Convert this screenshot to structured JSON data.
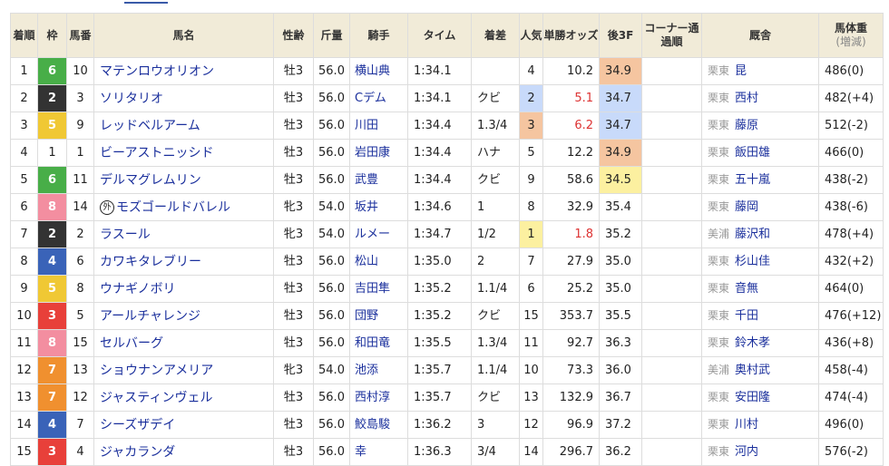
{
  "headers": {
    "rank": "着順",
    "waku": "枠",
    "uma": "馬番",
    "name": "馬名",
    "sexage": "性齢",
    "weight": "斤量",
    "jockey": "騎手",
    "time": "タイム",
    "margin": "着差",
    "pop": "人気",
    "odds": "単勝オッズ",
    "last3f": "後3F",
    "corner": "コーナー通過順",
    "trainer": "厩舎",
    "body": "馬体重",
    "body_sub": "(増減)"
  },
  "bracket_colors": {
    "1": "#ffffff",
    "2": "#333333",
    "3": "#e8403a",
    "4": "#3a63b8",
    "5": "#f0c834",
    "6": "#48ae48",
    "7": "#f0902f",
    "8": "#f38ea0"
  },
  "rows": [
    {
      "rank": "1",
      "waku": "6",
      "waku_color": "#48ae48",
      "uma": "10",
      "name": "マテンロウオリオン",
      "mark": "",
      "sexage": "牡3",
      "weight": "56.0",
      "jockey": "横山典",
      "time": "1:34.1",
      "margin": "",
      "pop": "4",
      "odds": "10.2",
      "odds_red": false,
      "last3f": "34.9",
      "f3hl": "o",
      "pophl": "",
      "aff": "栗東",
      "trainer": "昆",
      "body": "486(0)"
    },
    {
      "rank": "2",
      "waku": "2",
      "waku_color": "#333333",
      "uma": "3",
      "name": "ソリタリオ",
      "mark": "",
      "sexage": "牡3",
      "weight": "56.0",
      "jockey": "Cデム",
      "time": "1:34.1",
      "margin": "クビ",
      "pop": "2",
      "odds": "5.1",
      "odds_red": true,
      "last3f": "34.7",
      "f3hl": "b",
      "pophl": "b",
      "aff": "栗東",
      "trainer": "西村",
      "body": "482(+4)"
    },
    {
      "rank": "3",
      "waku": "5",
      "waku_color": "#f0c834",
      "uma": "9",
      "name": "レッドベルアーム",
      "mark": "",
      "sexage": "牡3",
      "weight": "56.0",
      "jockey": "川田",
      "time": "1:34.4",
      "margin": "1.3/4",
      "pop": "3",
      "odds": "6.2",
      "odds_red": true,
      "last3f": "34.7",
      "f3hl": "b",
      "pophl": "o",
      "aff": "栗東",
      "trainer": "藤原",
      "body": "512(-2)"
    },
    {
      "rank": "4",
      "waku": "1",
      "waku_color": "#ffffff",
      "uma": "1",
      "name": "ビーアストニッシド",
      "mark": "",
      "sexage": "牡3",
      "weight": "56.0",
      "jockey": "岩田康",
      "time": "1:34.4",
      "margin": "ハナ",
      "pop": "5",
      "odds": "12.2",
      "odds_red": false,
      "last3f": "34.9",
      "f3hl": "o",
      "pophl": "",
      "aff": "栗東",
      "trainer": "飯田雄",
      "body": "466(0)"
    },
    {
      "rank": "5",
      "waku": "6",
      "waku_color": "#48ae48",
      "uma": "11",
      "name": "デルマグレムリン",
      "mark": "",
      "sexage": "牡3",
      "weight": "56.0",
      "jockey": "武豊",
      "time": "1:34.4",
      "margin": "クビ",
      "pop": "9",
      "odds": "58.6",
      "odds_red": false,
      "last3f": "34.5",
      "f3hl": "y",
      "pophl": "",
      "aff": "栗東",
      "trainer": "五十嵐",
      "body": "438(-2)"
    },
    {
      "rank": "6",
      "waku": "8",
      "waku_color": "#f38ea0",
      "uma": "14",
      "name": "モズゴールドバレル",
      "mark": "外",
      "sexage": "牝3",
      "weight": "54.0",
      "jockey": "坂井",
      "time": "1:34.6",
      "margin": "1",
      "pop": "8",
      "odds": "32.9",
      "odds_red": false,
      "last3f": "35.4",
      "f3hl": "",
      "pophl": "",
      "aff": "栗東",
      "trainer": "藤岡",
      "body": "438(-6)"
    },
    {
      "rank": "7",
      "waku": "2",
      "waku_color": "#333333",
      "uma": "2",
      "name": "ラスール",
      "mark": "",
      "sexage": "牝3",
      "weight": "54.0",
      "jockey": "ルメー",
      "time": "1:34.7",
      "margin": "1/2",
      "pop": "1",
      "odds": "1.8",
      "odds_red": true,
      "last3f": "35.2",
      "f3hl": "",
      "pophl": "y",
      "aff": "美浦",
      "trainer": "藤沢和",
      "body": "478(+4)"
    },
    {
      "rank": "8",
      "waku": "4",
      "waku_color": "#3a63b8",
      "uma": "6",
      "name": "カワキタレブリー",
      "mark": "",
      "sexage": "牡3",
      "weight": "56.0",
      "jockey": "松山",
      "time": "1:35.0",
      "margin": "2",
      "pop": "7",
      "odds": "27.9",
      "odds_red": false,
      "last3f": "35.0",
      "f3hl": "",
      "pophl": "",
      "aff": "栗東",
      "trainer": "杉山佳",
      "body": "432(+2)"
    },
    {
      "rank": "9",
      "waku": "5",
      "waku_color": "#f0c834",
      "uma": "8",
      "name": "ウナギノボリ",
      "mark": "",
      "sexage": "牡3",
      "weight": "56.0",
      "jockey": "吉田隼",
      "time": "1:35.2",
      "margin": "1.1/4",
      "pop": "6",
      "odds": "25.2",
      "odds_red": false,
      "last3f": "35.0",
      "f3hl": "",
      "pophl": "",
      "aff": "栗東",
      "trainer": "音無",
      "body": "464(0)"
    },
    {
      "rank": "10",
      "waku": "3",
      "waku_color": "#e8403a",
      "uma": "5",
      "name": "アールチャレンジ",
      "mark": "",
      "sexage": "牡3",
      "weight": "56.0",
      "jockey": "団野",
      "time": "1:35.2",
      "margin": "クビ",
      "pop": "15",
      "odds": "353.7",
      "odds_red": false,
      "last3f": "35.5",
      "f3hl": "",
      "pophl": "",
      "aff": "栗東",
      "trainer": "千田",
      "body": "476(+12)"
    },
    {
      "rank": "11",
      "waku": "8",
      "waku_color": "#f38ea0",
      "uma": "15",
      "name": "セルバーグ",
      "mark": "",
      "sexage": "牡3",
      "weight": "56.0",
      "jockey": "和田竜",
      "time": "1:35.5",
      "margin": "1.3/4",
      "pop": "11",
      "odds": "92.7",
      "odds_red": false,
      "last3f": "36.3",
      "f3hl": "",
      "pophl": "",
      "aff": "栗東",
      "trainer": "鈴木孝",
      "body": "436(+8)"
    },
    {
      "rank": "12",
      "waku": "7",
      "waku_color": "#f0902f",
      "uma": "13",
      "name": "ショウナンアメリア",
      "mark": "",
      "sexage": "牝3",
      "weight": "54.0",
      "jockey": "池添",
      "time": "1:35.7",
      "margin": "1.1/4",
      "pop": "10",
      "odds": "73.3",
      "odds_red": false,
      "last3f": "36.0",
      "f3hl": "",
      "pophl": "",
      "aff": "美浦",
      "trainer": "奥村武",
      "body": "458(-4)"
    },
    {
      "rank": "13",
      "waku": "7",
      "waku_color": "#f0902f",
      "uma": "12",
      "name": "ジャスティンヴェル",
      "mark": "",
      "sexage": "牡3",
      "weight": "56.0",
      "jockey": "西村淳",
      "time": "1:35.7",
      "margin": "クビ",
      "pop": "13",
      "odds": "132.9",
      "odds_red": false,
      "last3f": "36.7",
      "f3hl": "",
      "pophl": "",
      "aff": "栗東",
      "trainer": "安田隆",
      "body": "474(-4)"
    },
    {
      "rank": "14",
      "waku": "4",
      "waku_color": "#3a63b8",
      "uma": "7",
      "name": "シーズザデイ",
      "mark": "",
      "sexage": "牡3",
      "weight": "56.0",
      "jockey": "鮫島駿",
      "time": "1:36.2",
      "margin": "3",
      "pop": "12",
      "odds": "96.9",
      "odds_red": false,
      "last3f": "37.2",
      "f3hl": "",
      "pophl": "",
      "aff": "栗東",
      "trainer": "川村",
      "body": "496(0)"
    },
    {
      "rank": "15",
      "waku": "3",
      "waku_color": "#e8403a",
      "uma": "4",
      "name": "ジャカランダ",
      "mark": "",
      "sexage": "牡3",
      "weight": "56.0",
      "jockey": "幸",
      "time": "1:36.3",
      "margin": "3/4",
      "pop": "14",
      "odds": "296.7",
      "odds_red": false,
      "last3f": "36.2",
      "f3hl": "",
      "pophl": "",
      "aff": "栗東",
      "trainer": "河内",
      "body": "576(-2)"
    }
  ]
}
